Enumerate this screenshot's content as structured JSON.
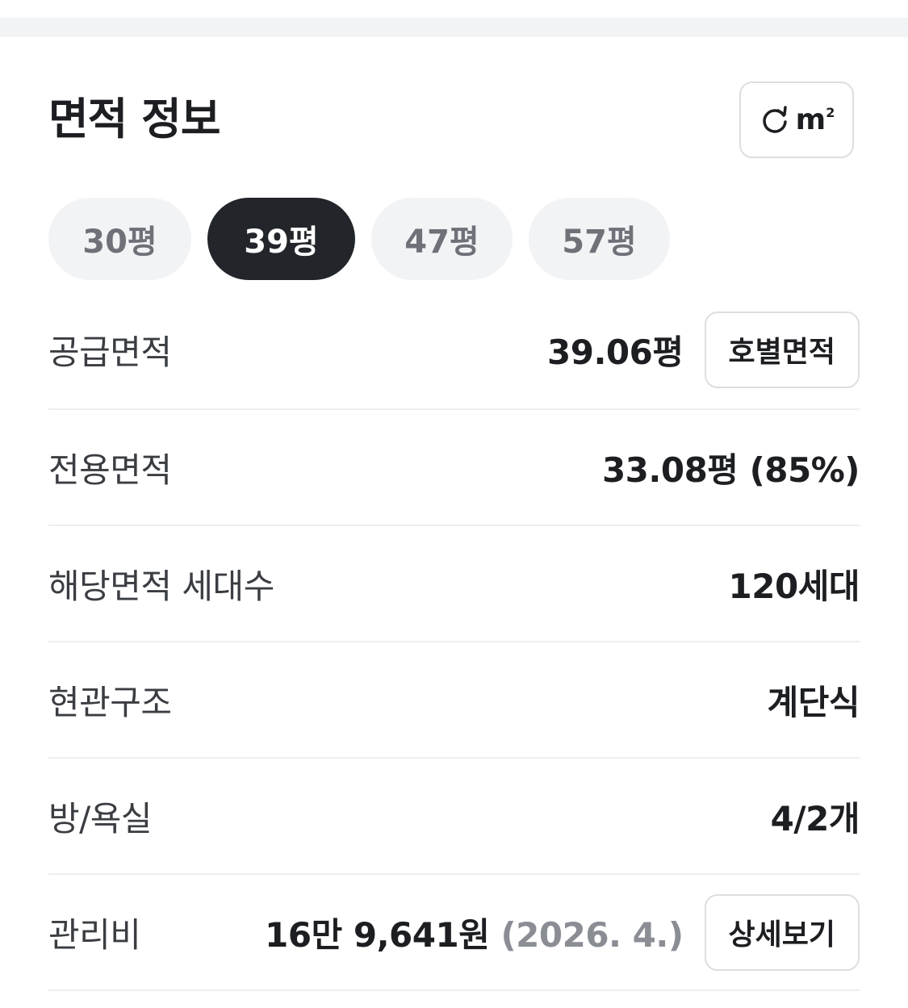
{
  "section": {
    "title": "면적 정보",
    "unit_toggle_label": "m",
    "unit_toggle_sup": "2"
  },
  "chips": [
    {
      "label": "30평",
      "active": false
    },
    {
      "label": "39평",
      "active": true
    },
    {
      "label": "47평",
      "active": false
    },
    {
      "label": "57평",
      "active": false
    }
  ],
  "rows": {
    "supply": {
      "label": "공급면적",
      "value": "39.06평",
      "button": "호별면적"
    },
    "exclusive": {
      "label": "전용면적",
      "value": "33.08평 (85%)"
    },
    "households": {
      "label": "해당면적 세대수",
      "value": "120세대"
    },
    "entrance": {
      "label": "현관구조",
      "value": "계단식"
    },
    "rooms": {
      "label": "방/욕실",
      "value": "4/2개"
    },
    "fee": {
      "label": "관리비",
      "value": "16만 9,641원",
      "date": "(2026. 4.)",
      "button": "상세보기"
    }
  },
  "colors": {
    "active_chip": "#222529",
    "chip_bg": "#f2f3f5",
    "divider": "#eceef0",
    "muted_text": "#8a8e94"
  }
}
